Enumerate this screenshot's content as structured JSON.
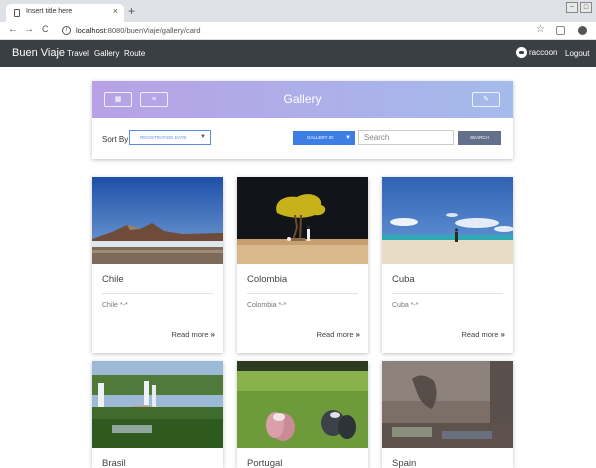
{
  "browser": {
    "tab_title": "Insert title here",
    "tab_close": "×",
    "new_tab": "+",
    "url_host": "localhost",
    "url_rest": ":8080/buenViaje/gallery/card",
    "nav_back": "←",
    "nav_forward": "→",
    "nav_reload": "C",
    "star": "☆",
    "menu": "⋮"
  },
  "navbar": {
    "brand": "Buen Viaje",
    "links": [
      "Travel",
      "Gallery",
      "Route"
    ],
    "username": "raccoon",
    "logout": "Logout"
  },
  "gallery": {
    "title": "Gallery",
    "sort_label": "Sort By",
    "sort_value": "REGISTRATION DATE",
    "filter_value": "GALLERY ID",
    "search_placeholder": "Search",
    "search_button": "SEARCH"
  },
  "cards": [
    {
      "title": "Chile",
      "subtitle": "Chile *-*",
      "more": "Read more"
    },
    {
      "title": "Colombia",
      "subtitle": "Colombia *-*",
      "more": "Read more"
    },
    {
      "title": "Cuba",
      "subtitle": "Cuba *-*",
      "more": "Read more"
    },
    {
      "title": "Brasil",
      "subtitle": "",
      "more": ""
    },
    {
      "title": "Portugal",
      "subtitle": "",
      "more": ""
    },
    {
      "title": "Spain",
      "subtitle": "",
      "more": ""
    }
  ],
  "colors": {
    "navbar": "#3a3f44",
    "header_gradient_start": "#b8a1e6",
    "header_gradient_end": "#a4bbeb",
    "primary_blue": "#3d7ee6",
    "search_button": "#64708b"
  }
}
